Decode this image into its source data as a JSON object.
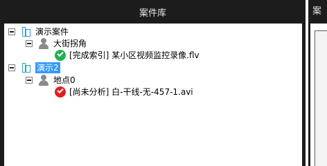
{
  "panel": {
    "title": "案件库"
  },
  "right_panel": {
    "title": "案"
  },
  "tree": {
    "case1": {
      "label": "演示案件",
      "location": {
        "label": "大街拐角",
        "video": {
          "label": "[完成索引] 某小区视频监控录像.flv",
          "status": "indexed"
        }
      }
    },
    "case2": {
      "label": "演示2",
      "location": {
        "label": "地点0",
        "video": {
          "label": "[尚未分析] 白-干线-无-457-1.avi",
          "status": "not-analyzed"
        }
      }
    }
  },
  "colors": {
    "selection": "#3399ff",
    "indexed": "#22b14c",
    "not_analyzed": "#e02020",
    "case_icon": "#2aa0b8"
  }
}
